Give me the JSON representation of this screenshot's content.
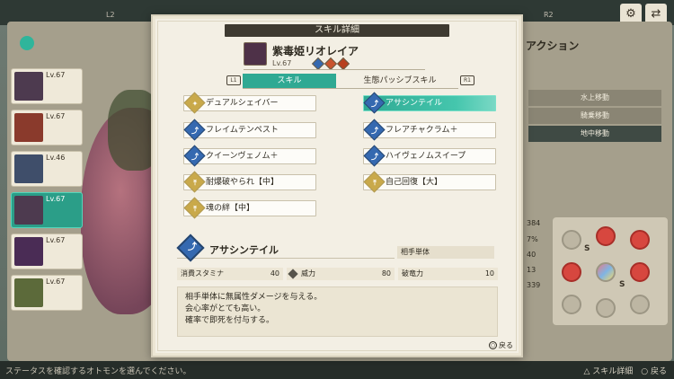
{
  "dialog": {
    "title": "スキル詳細",
    "monster_name": "紫毒姫リオレイア",
    "monster_level": "Lv.67",
    "tabs": {
      "l1": "L1",
      "active": "スキル",
      "inactive": "生態パッシブスキル",
      "r1": "R1"
    },
    "skills": [
      {
        "label": "デュアルシェイバー",
        "color": "gold",
        "glyph": "✦",
        "selected": false
      },
      {
        "label": "アサシンテイル",
        "color": "blue",
        "glyph": "⤴",
        "selected": true
      },
      {
        "label": "フレイムテンペスト",
        "color": "blue",
        "glyph": "⤴",
        "selected": false
      },
      {
        "label": "フレアチャクラム＋",
        "color": "blue",
        "glyph": "⤴",
        "selected": false
      },
      {
        "label": "クイーンヴェノム＋",
        "color": "blue",
        "glyph": "⤴",
        "selected": false
      },
      {
        "label": "ハイヴェノムスイープ",
        "color": "blue",
        "glyph": "⤴",
        "selected": false
      },
      {
        "label": "耐爆破やられ【中】",
        "color": "gold",
        "glyph": "⤒",
        "selected": false
      },
      {
        "label": "自己回復【大】",
        "color": "gold",
        "glyph": "⤒",
        "selected": false
      },
      {
        "label": "魂の絆【中】",
        "color": "gold",
        "glyph": "⤒",
        "selected": false
      }
    ],
    "detail": {
      "name": "アサシンテイル",
      "target": "相手単体",
      "stamina_label": "消費スタミナ",
      "stamina_value": "40",
      "power_label": "威力",
      "power_value": "80",
      "break_label": "破竜力",
      "break_value": "10",
      "description": [
        "相手単体に無属性ダメージを与える。",
        "会心率がとても高い。",
        "確率で即死を付与する。"
      ]
    },
    "back_label": "戻る",
    "back_button": "○"
  },
  "background": {
    "top_left_button": "L2",
    "top_right_button": "R2",
    "action_label": "アクション",
    "movement": [
      "水上移動",
      "騎乗移動",
      "地中移動"
    ],
    "roster_levels": [
      "Lv.67",
      "Lv.67",
      "Lv.46",
      "Lv.67",
      "Lv.67",
      "Lv.67"
    ],
    "right_stats": [
      "384",
      "7%",
      "40",
      "13",
      "339"
    ],
    "bottom_hint": "ステータスを確認するオトモンを選んでください。",
    "bottom_right": "スキル詳細",
    "bottom_right_2": "戻る",
    "wheel_labels": [
      "S",
      "S"
    ]
  }
}
